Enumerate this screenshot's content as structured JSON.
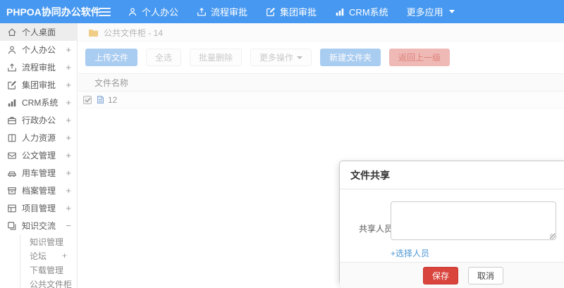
{
  "header": {
    "logo": "PHPOA协同办公软件",
    "nav": [
      {
        "label": "个人办公",
        "icon": "user-icon"
      },
      {
        "label": "流程审批",
        "icon": "process-icon"
      },
      {
        "label": "集团审批",
        "icon": "approval-icon"
      },
      {
        "label": "CRM系统",
        "icon": "chart-icon"
      },
      {
        "label": "更多应用",
        "icon": "caret-down-icon"
      }
    ]
  },
  "sidebar": {
    "items": [
      {
        "label": "个人桌面",
        "icon": "home-icon",
        "suffix": "",
        "active": true
      },
      {
        "label": "个人办公",
        "icon": "user-icon",
        "suffix": "+"
      },
      {
        "label": "流程审批",
        "icon": "process-icon",
        "suffix": "+"
      },
      {
        "label": "集团审批",
        "icon": "approval-icon",
        "suffix": "+"
      },
      {
        "label": "CRM系统",
        "icon": "chart-icon",
        "suffix": "+"
      },
      {
        "label": "行政办公",
        "icon": "briefcase-icon",
        "suffix": "+"
      },
      {
        "label": "人力资源",
        "icon": "hr-book-icon",
        "suffix": "+"
      },
      {
        "label": "公文管理",
        "icon": "document-icon",
        "suffix": "+"
      },
      {
        "label": "用车管理",
        "icon": "vehicle-icon",
        "suffix": "+"
      },
      {
        "label": "档案管理",
        "icon": "archive-icon",
        "suffix": "+"
      },
      {
        "label": "项目管理",
        "icon": "project-icon",
        "suffix": "+"
      },
      {
        "label": "知识交流",
        "icon": "knowledge-icon",
        "suffix": "−"
      }
    ],
    "subitems": [
      {
        "label": "知识管理",
        "suffix": ""
      },
      {
        "label": "论坛",
        "suffix": "+"
      },
      {
        "label": "下载管理",
        "suffix": ""
      },
      {
        "label": "公共文件柜",
        "suffix": ""
      }
    ]
  },
  "breadcrumb": {
    "icon": "folder-icon",
    "text": "公共文件柜 - 14"
  },
  "toolbar": {
    "buttons": [
      {
        "label": "上传文件",
        "style": "primary-light"
      },
      {
        "label": "全选",
        "style": "default"
      },
      {
        "label": "批量删除",
        "style": "default"
      },
      {
        "label": "更多操作",
        "style": "default",
        "caret": true
      },
      {
        "label": "新建文件夹",
        "style": "primary-light"
      },
      {
        "label": "返回上一级",
        "style": "danger-light"
      }
    ]
  },
  "table": {
    "name_header": "文件名称",
    "rows": [
      {
        "name": "12",
        "icon": "file-icon",
        "checked": true
      }
    ]
  },
  "modal": {
    "title": "文件共享",
    "share_label": "共享人员",
    "textarea_value": "",
    "select_link": "+选择人员",
    "save_label": "保存",
    "cancel_label": "取消"
  },
  "colors": {
    "header_bg": "#4798f0",
    "active_item_bg": "#ededed",
    "primary_light_btn": "#a9ccf1",
    "danger_light_btn": "#efb9b5",
    "save_btn": "#d9443d",
    "link_blue": "#4b96d5",
    "folder_yellow": "#f0cc84",
    "file_icon_blue": "#84a8d4"
  }
}
